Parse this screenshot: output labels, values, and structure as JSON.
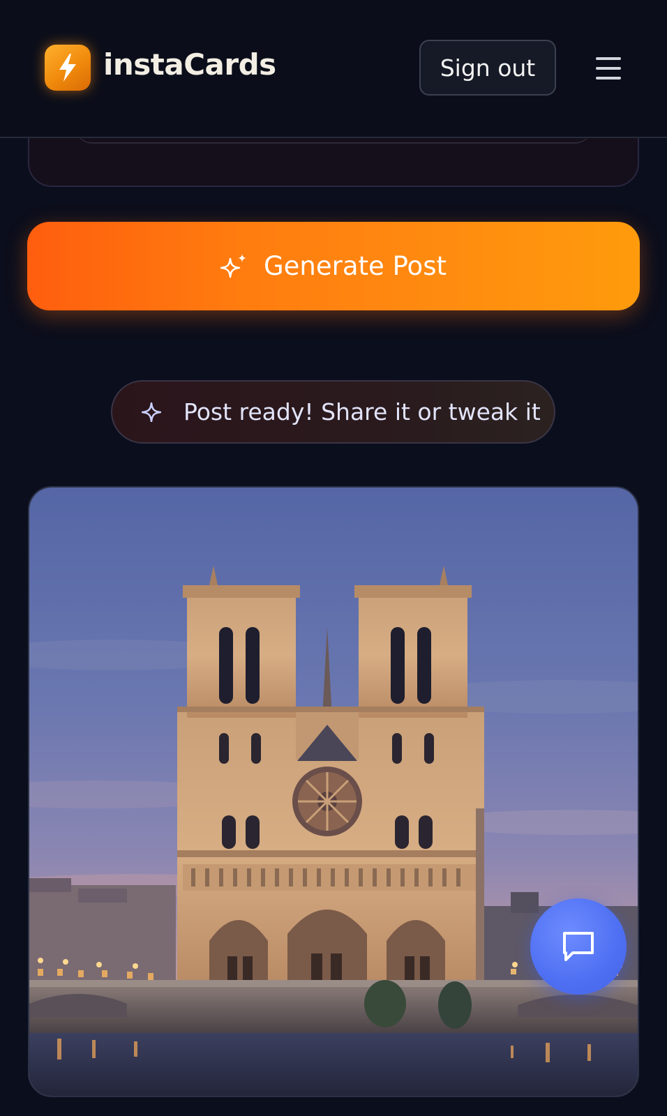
{
  "header": {
    "brand": "instaCards",
    "sign_out_label": "Sign out"
  },
  "actions": {
    "generate_label": "Generate Post"
  },
  "status": {
    "message": "Post ready! Share it or tweak it"
  },
  "icons": {
    "logo": "lightning-bolt-icon",
    "menu": "hamburger-menu-icon",
    "generate": "sparkles-icon",
    "status": "sparkle-icon",
    "chat": "chat-bubble-icon"
  },
  "colors": {
    "background": "#0b0e1c",
    "accent_start": "#ff5e0e",
    "accent_end": "#ff9b0c",
    "chat_fab": "#4e6ff2"
  },
  "generated_image": {
    "subject": "cathedral-photo"
  }
}
